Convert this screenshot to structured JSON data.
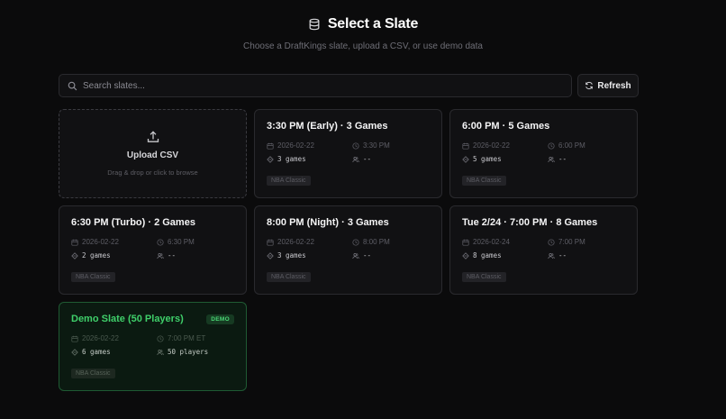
{
  "page": {
    "title": "Select a Slate",
    "subtitle": "Choose a DraftKings slate, upload a CSV, or use demo data"
  },
  "search": {
    "placeholder": "Search slates...",
    "value": ""
  },
  "refresh_label": "Refresh",
  "upload": {
    "title": "Upload CSV",
    "hint": "Drag & drop or click to browse"
  },
  "slates": [
    {
      "title": "3:30 PM (Early) · 3 Games",
      "date": "2026-02-22",
      "time": "3:30 PM",
      "games": "3 games",
      "players": "--",
      "tag": "NBA Classic"
    },
    {
      "title": "6:00 PM · 5 Games",
      "date": "2026-02-22",
      "time": "6:00 PM",
      "games": "5 games",
      "players": "--",
      "tag": "NBA Classic"
    },
    {
      "title": "6:30 PM (Turbo) · 2 Games",
      "date": "2026-02-22",
      "time": "6:30 PM",
      "games": "2 games",
      "players": "--",
      "tag": "NBA Classic"
    },
    {
      "title": "8:00 PM (Night) · 3 Games",
      "date": "2026-02-22",
      "time": "8:00 PM",
      "games": "3 games",
      "players": "--",
      "tag": "NBA Classic"
    },
    {
      "title": "Tue 2/24 · 7:00 PM · 8 Games",
      "date": "2026-02-24",
      "time": "7:00 PM",
      "games": "8 games",
      "players": "--",
      "tag": "NBA Classic"
    }
  ],
  "demo": {
    "title": "Demo Slate (50 Players)",
    "badge": "DEMO",
    "date": "2026-02-22",
    "time": "7:00 PM ET",
    "games": "6 games",
    "players": "50 players",
    "tag": "NBA Classic"
  },
  "colors": {
    "background": "#0b0b0c",
    "card": "#111113",
    "border": "#2a2a2e",
    "accent_green": "#3fcf6a"
  },
  "icons": {
    "header": "database-icon",
    "search": "search-icon",
    "refresh": "refresh-icon",
    "upload": "upload-icon",
    "date": "calendar-icon",
    "time": "clock-icon",
    "games": "diamond-icon",
    "players": "users-icon"
  }
}
